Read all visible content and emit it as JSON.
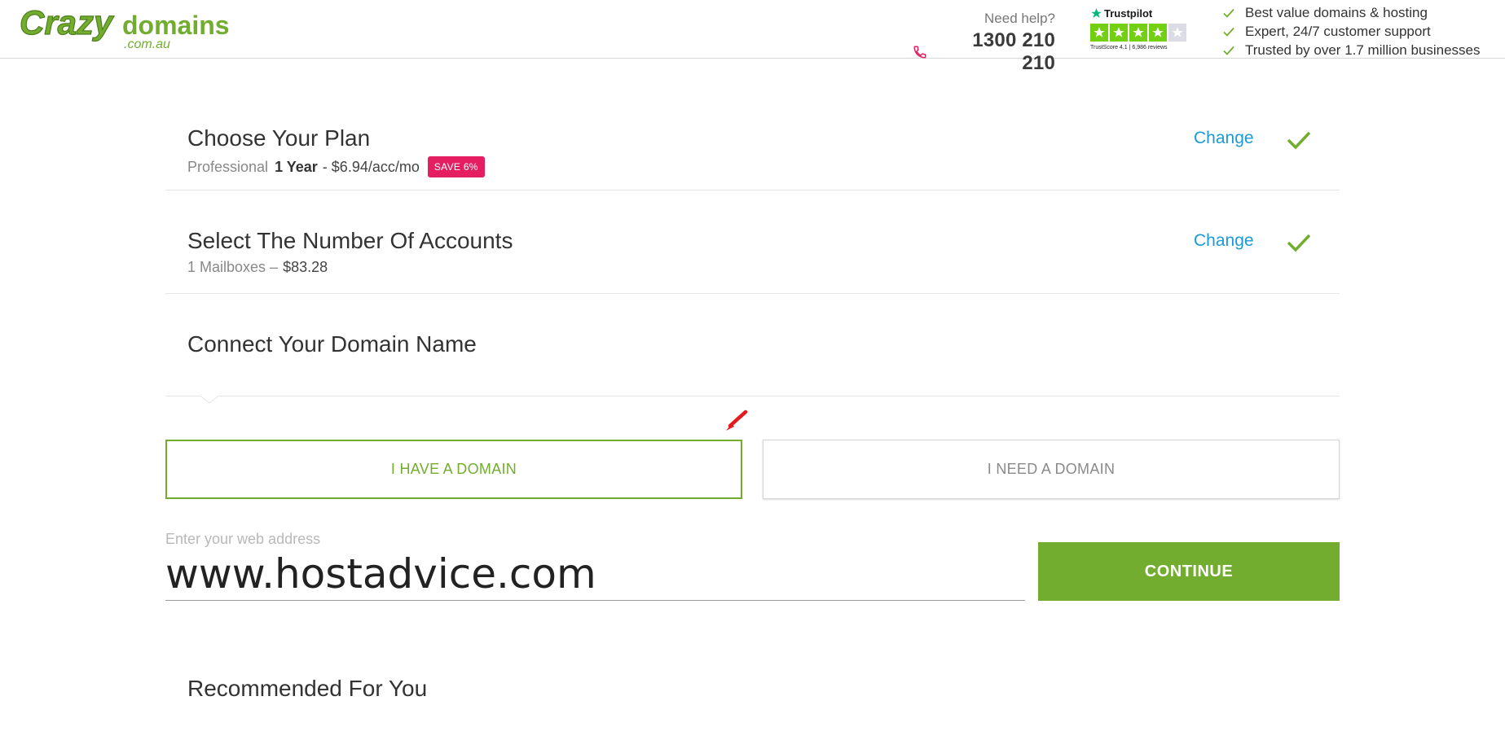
{
  "brand": {
    "logo_main": "Crazy",
    "logo_second": "domains",
    "logo_sub": ".com.au",
    "color_green": "#72ad2f",
    "color_pink": "#e51e61",
    "color_blue_link": "#1a9ad9"
  },
  "header": {
    "help_label": "Need help?",
    "phone": "1300 210 210",
    "trustpilot": {
      "brand": "Trustpilot",
      "score_text": "TrustScore 4.1 | 6,986 reviews",
      "rating": 4.1,
      "max": 5
    },
    "benefits": [
      "Best value domains & hosting",
      "Expert, 24/7 customer support",
      "Trusted by over 1.7 million businesses"
    ]
  },
  "steps": {
    "plan": {
      "title": "Choose Your Plan",
      "plan_name": "Professional",
      "term": "1 Year",
      "price": "- $6.94/acc/mo",
      "badge": "SAVE 6%",
      "change": "Change"
    },
    "accounts": {
      "title": "Select The Number Of Accounts",
      "mailboxes": "1 Mailboxes –",
      "price": "$83.28",
      "change": "Change"
    },
    "domain": {
      "title": "Connect Your Domain Name",
      "option_have": "I HAVE A DOMAIN",
      "option_need": "I NEED A DOMAIN",
      "input_label": "Enter your web address",
      "input_value": "www.hostadvice.com",
      "continue": "CONTINUE"
    }
  },
  "recommended": {
    "title": "Recommended For You"
  }
}
